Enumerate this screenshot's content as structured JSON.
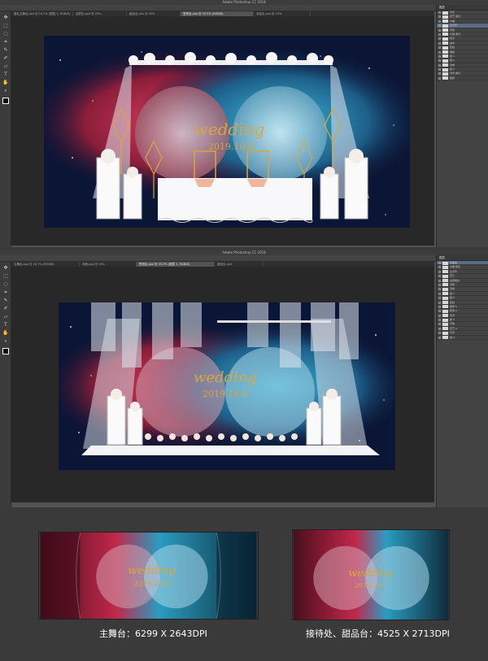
{
  "window1": {
    "app_title": "Adobe Photoshop CC 2018",
    "options": [
      "自动选择",
      "图层",
      "显示变换控件"
    ],
    "tabs": [
      {
        "label": "婚礼主舞台.psd @ 16.7% (图层 2, RGB/8)"
      },
      {
        "label": "迎宾区.psd @ 25%"
      },
      {
        "label": "甜品台.psd @ 20%"
      },
      {
        "label": "签到台.psd @ 33.3% (RGB/8)",
        "active": true
      },
      {
        "label": "合影区.psd @ 25%"
      }
    ],
    "panel_title": "图层",
    "layers": [
      "背景",
      "花艺 拷贝",
      "纱幔",
      "主背景",
      "月球",
      "灯架 拷贝",
      "椅子",
      "桌布",
      "花柱",
      "地毯",
      "组 1",
      "组 2",
      "光效",
      "组 3",
      "背景 拷贝",
      "装饰"
    ],
    "selected_layer_index": 3
  },
  "window2": {
    "app_title": "Adobe Photoshop CC 2018",
    "options": [
      "自动选择",
      "图层",
      "显示变换控件"
    ],
    "tabs": [
      {
        "label": "主舞台.psd @ 16.7% (RGB/8)"
      },
      {
        "label": "背景.psd @ 25%"
      },
      {
        "label": "签到区.psd @ 33.3% (图层 1, RGB/8)",
        "active": true
      },
      {
        "label": "甜品台.psd"
      }
    ],
    "panel_title": "图层",
    "layers": [
      "水晶柱",
      "纱幔 拷贝",
      "主背景",
      "花艺",
      "白色舞台",
      "月球",
      "光效",
      "组 1",
      "组 2",
      "花柱",
      "装饰 1",
      "装饰 2",
      "背景",
      "组 3",
      "字体",
      "花艺 2",
      "灯光",
      "组 4"
    ],
    "selected_layer_index": 0
  },
  "scene": {
    "wedding_text": "wedding",
    "date_text": "2019.10.0"
  },
  "captions": {
    "main_stage": "主舞台：6299 X 2643DPI",
    "reception": "接待处、甜品台：4525 X 2713DPI"
  },
  "colors": {
    "red_nebula": "#c0284a",
    "blue_nebula": "#2a9cc0",
    "gold": "#d8a640",
    "space": "#0b1535"
  },
  "icons": [
    "move-tool-icon",
    "marquee-tool-icon",
    "lasso-tool-icon",
    "crop-tool-icon",
    "eyedropper-tool-icon",
    "brush-tool-icon",
    "eraser-tool-icon",
    "text-tool-icon",
    "hand-tool-icon",
    "zoom-tool-icon"
  ]
}
